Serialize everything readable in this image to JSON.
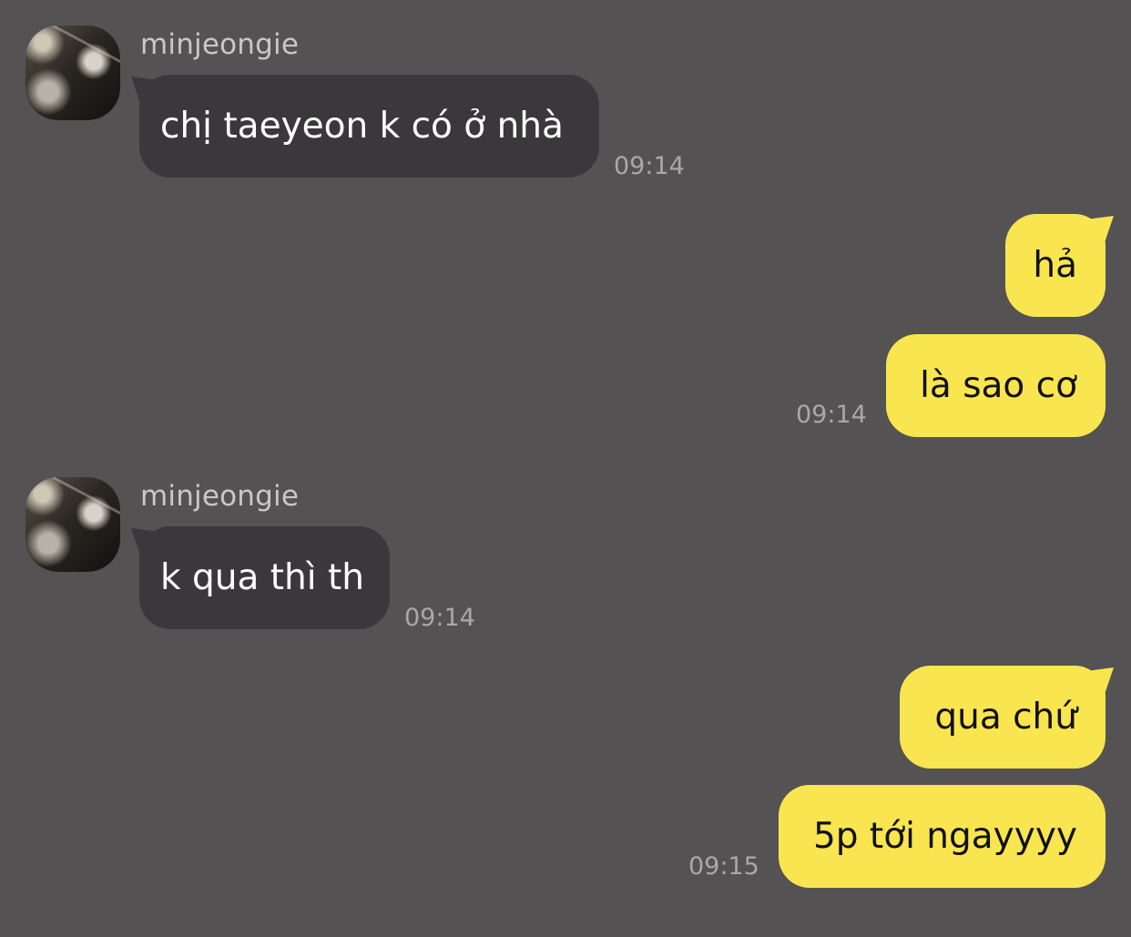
{
  "messages": [
    {
      "sender": "minjeongie",
      "text": "chị taeyeon k có ở nhà",
      "time": "09:14"
    },
    {
      "text": "hả"
    },
    {
      "text": "là sao cơ",
      "time": "09:14"
    },
    {
      "sender": "minjeongie",
      "text": "k qua thì th",
      "time": "09:14"
    },
    {
      "text": "qua chứ"
    },
    {
      "text": "5p tới ngayyyy",
      "time": "09:15"
    }
  ]
}
